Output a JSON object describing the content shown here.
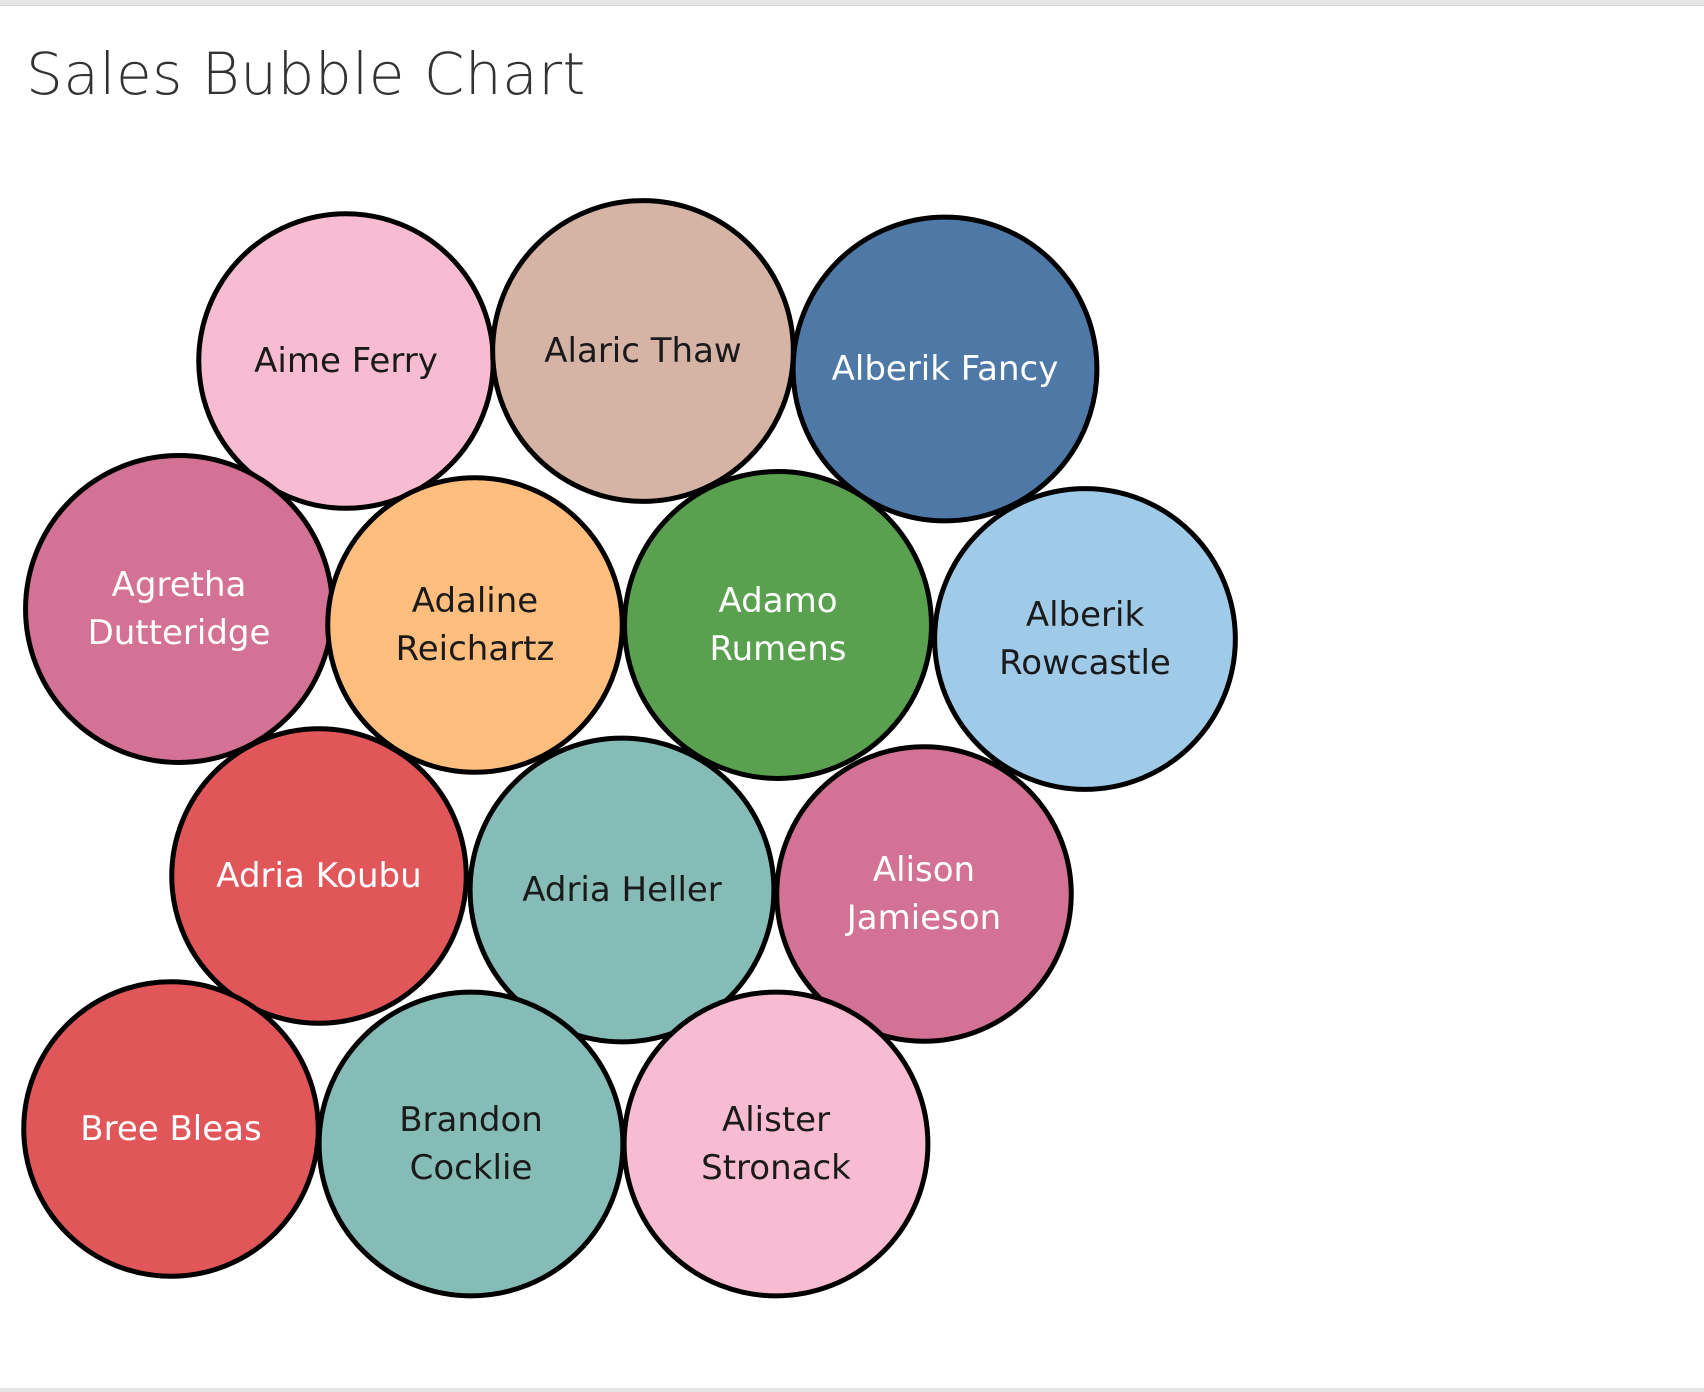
{
  "title": "Sales Bubble Chart",
  "colors": {
    "outline": "#000000",
    "pink": "#f8bcd2",
    "tan": "#d5b4a6",
    "blue": "#4e79a7",
    "mauve": "#d37295",
    "orange": "#ffbe7d",
    "green": "#59a14f",
    "light-blue": "#a0cbe8",
    "red": "#e15759",
    "teal": "#86bcb6"
  },
  "chart_data": {
    "type": "bubble",
    "title": "Sales Bubble Chart",
    "note": "packed bubbles; relative size only, no values printed",
    "series": [
      {
        "name": "Aime Ferry",
        "lines": [
          "Aime Ferry"
        ],
        "color": "#f8bcd2",
        "text_color": "#1a1a1a",
        "size": 0.95
      },
      {
        "name": "Alaric Thaw",
        "lines": [
          "Alaric Thaw"
        ],
        "color": "#d5b4a6",
        "text_color": "#1a1a1a",
        "size": 0.97
      },
      {
        "name": "Alberik Fancy",
        "lines": [
          "Alberik Fancy"
        ],
        "color": "#4e79a7",
        "text_color": "#ffffff",
        "size": 0.98
      },
      {
        "name": "Agretha Dutteridge",
        "lines": [
          "Agretha",
          "Dutteridge"
        ],
        "color": "#d37295",
        "text_color": "#ffffff",
        "size": 0.99
      },
      {
        "name": "Adaline Reichartz",
        "lines": [
          "Adaline",
          "Reichartz"
        ],
        "color": "#ffbe7d",
        "text_color": "#1a1a1a",
        "size": 0.95
      },
      {
        "name": "Adamo Rumens",
        "lines": [
          "Adamo",
          "Rumens"
        ],
        "color": "#59a14f",
        "text_color": "#ffffff",
        "size": 0.99
      },
      {
        "name": "Alberik Rowcastle",
        "lines": [
          "Alberik",
          "Rowcastle"
        ],
        "color": "#a0cbe8",
        "text_color": "#1a1a1a",
        "size": 0.97
      },
      {
        "name": "Adria Koubu",
        "lines": [
          "Adria Koubu"
        ],
        "color": "#e15759",
        "text_color": "#ffffff",
        "size": 0.95
      },
      {
        "name": "Adria Heller",
        "lines": [
          "Adria Heller"
        ],
        "color": "#86bcb6",
        "text_color": "#1a1a1a",
        "size": 0.98
      },
      {
        "name": "Alison Jamieson",
        "lines": [
          "Alison",
          "Jamieson"
        ],
        "color": "#d37295",
        "text_color": "#ffffff",
        "size": 0.95
      },
      {
        "name": "Bree Bleas",
        "lines": [
          "Bree Bleas"
        ],
        "color": "#e15759",
        "text_color": "#ffffff",
        "size": 0.95
      },
      {
        "name": "Brandon Cocklie",
        "lines": [
          "Brandon",
          "Cocklie"
        ],
        "color": "#86bcb6",
        "text_color": "#1a1a1a",
        "size": 0.98
      },
      {
        "name": "Alister Stronack",
        "lines": [
          "Alister",
          "Stronack"
        ],
        "color": "#f8bcd2",
        "text_color": "#1a1a1a",
        "size": 0.98
      }
    ]
  }
}
